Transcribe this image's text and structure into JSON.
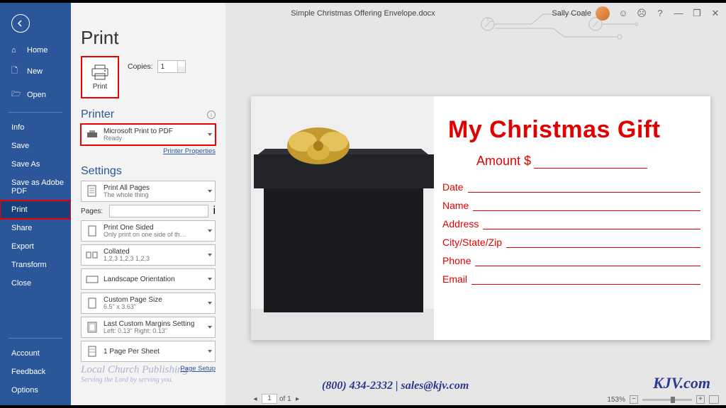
{
  "titlebar": {
    "filename": "Simple Christmas Offering Envelope.docx",
    "user": "Sally Coale"
  },
  "sidebar": {
    "items": [
      {
        "label": "Home",
        "icon": "home-icon"
      },
      {
        "label": "New",
        "icon": "new-icon"
      },
      {
        "label": "Open",
        "icon": "open-icon"
      }
    ],
    "items2": [
      {
        "label": "Info"
      },
      {
        "label": "Save"
      },
      {
        "label": "Save As"
      },
      {
        "label": "Save as Adobe PDF"
      },
      {
        "label": "Print",
        "selected": true
      },
      {
        "label": "Share"
      },
      {
        "label": "Export"
      },
      {
        "label": "Transform"
      },
      {
        "label": "Close"
      }
    ],
    "bottom": [
      {
        "label": "Account"
      },
      {
        "label": "Feedback"
      },
      {
        "label": "Options"
      }
    ]
  },
  "print": {
    "heading": "Print",
    "button": "Print",
    "copies_label": "Copies:",
    "copies_value": "1",
    "printer_heading": "Printer",
    "printer_name": "Microsoft Print to PDF",
    "printer_status": "Ready",
    "printer_props": "Printer Properties",
    "settings_heading": "Settings",
    "pages_label": "Pages:",
    "page_setup": "Page Setup",
    "options": [
      {
        "l1": "Print All Pages",
        "l2": "The whole thing",
        "icon": "pages-icon"
      },
      {
        "l1": "Print One Sided",
        "l2": "Only print on one side of th…",
        "icon": "onesided-icon"
      },
      {
        "l1": "Collated",
        "l2": "1,2,3   1,2,3   1,2,3",
        "icon": "collated-icon"
      },
      {
        "l1": "Landscape Orientation",
        "l2": "",
        "icon": "landscape-icon"
      },
      {
        "l1": "Custom Page Size",
        "l2": "6.5\" x 3.63\"",
        "icon": "pagesize-icon"
      },
      {
        "l1": "Last Custom Margins Setting",
        "l2": "Left: 0.13\"   Right: 0.13\"",
        "icon": "margins-icon"
      },
      {
        "l1": "1 Page Per Sheet",
        "l2": "",
        "icon": "persheet-icon"
      }
    ]
  },
  "document": {
    "title": "My Christmas Gift",
    "amount": "Amount $",
    "fields": [
      "Date",
      "Name",
      "Address",
      "City/State/Zip",
      "Phone",
      "Email"
    ]
  },
  "footer": {
    "contact": "(800) 434-2332 | sales@kjv.com",
    "logo": "KJV.com",
    "watermark_name": "Local Church Publishing",
    "watermark_tag": "Serving the Lord by serving you."
  },
  "status": {
    "page_current": "1",
    "page_total": "of 1",
    "zoom": "153%"
  }
}
